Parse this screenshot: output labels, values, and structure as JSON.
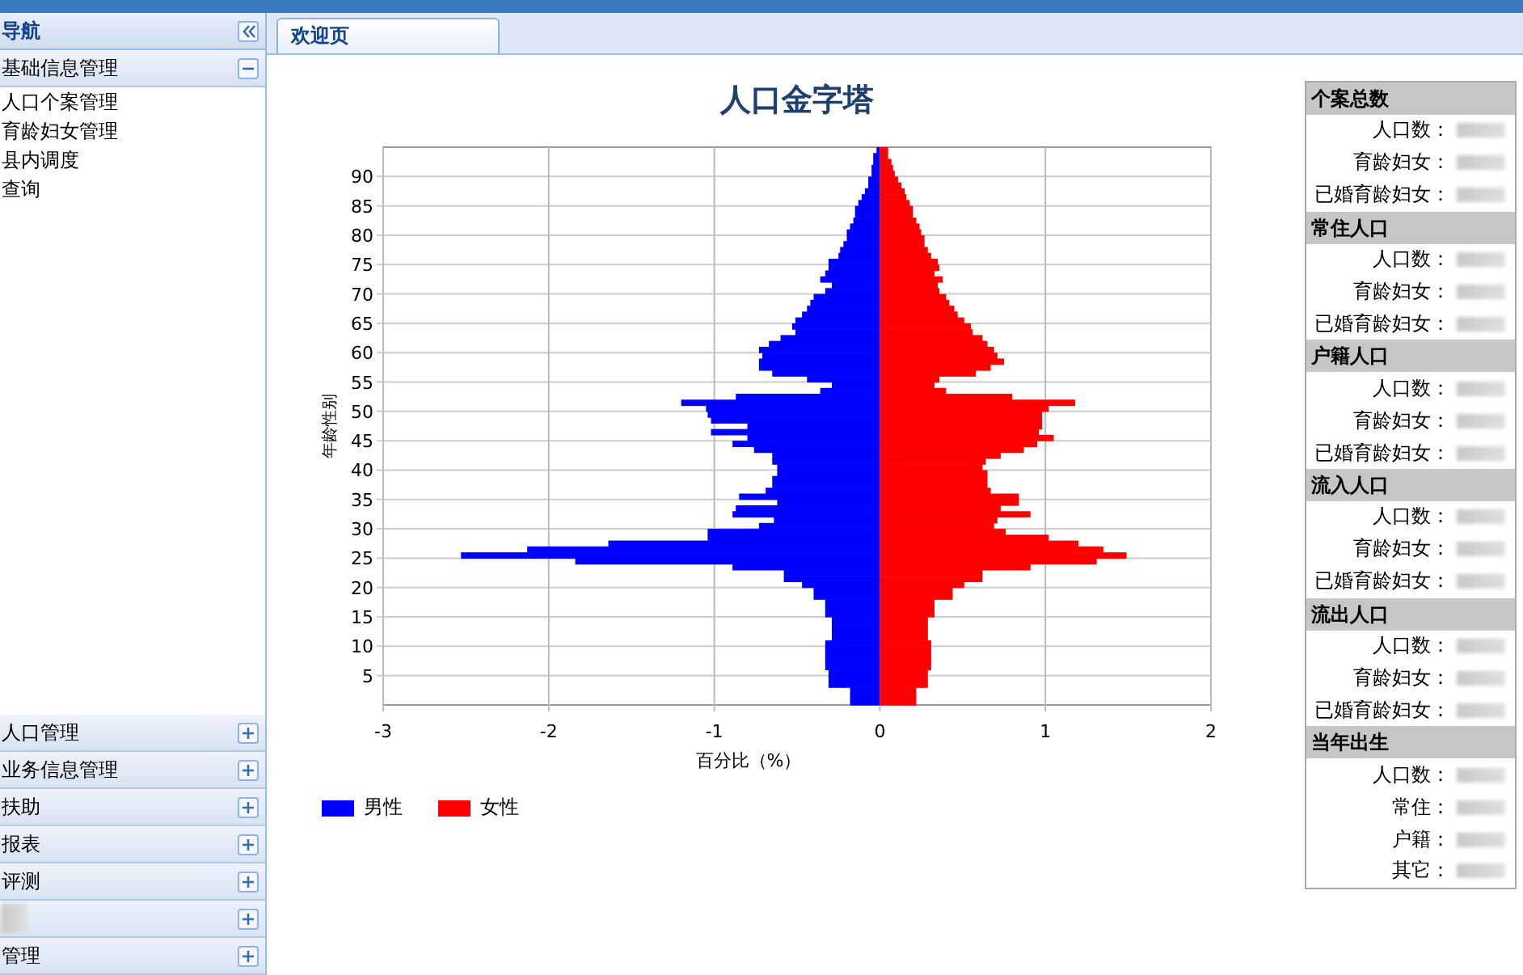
{
  "sidebar": {
    "title": "导航",
    "sections": [
      {
        "label": "基础信息管理",
        "expanded": true,
        "items": [
          "人口个案管理",
          "育龄妇女管理",
          "县内调度",
          "查询"
        ]
      },
      {
        "label": "人口管理",
        "expanded": false
      },
      {
        "label": "业务信息管理",
        "expanded": false
      },
      {
        "label": "扶助",
        "expanded": false
      },
      {
        "label": "报表",
        "expanded": false
      },
      {
        "label": "评测",
        "expanded": false
      },
      {
        "redacted": true,
        "expanded": false
      },
      {
        "label": "管理",
        "expanded": false
      }
    ]
  },
  "tabs": [
    {
      "label": "欢迎页",
      "selected": true
    }
  ],
  "chart_data": {
    "type": "bar",
    "orientation": "horizontal",
    "stacked": true,
    "grid": true,
    "title": "人口金字塔",
    "xlabel": "百分比（%）",
    "ylabel": "年龄性别",
    "xlim": [
      -3,
      2
    ],
    "xticks": [
      -3,
      -2,
      -1,
      0,
      1,
      2
    ],
    "ylim": [
      0,
      95
    ],
    "yticks": [
      5,
      10,
      15,
      20,
      25,
      30,
      35,
      40,
      45,
      50,
      55,
      60,
      65,
      70,
      75,
      80,
      85,
      90
    ],
    "x": [
      94,
      93,
      92,
      91,
      90,
      89,
      88,
      87,
      86,
      85,
      84,
      83,
      82,
      81,
      80,
      79,
      78,
      77,
      76,
      75,
      74,
      73,
      72,
      71,
      70,
      69,
      68,
      67,
      66,
      65,
      64,
      63,
      62,
      61,
      60,
      59,
      58,
      57,
      56,
      55,
      54,
      53,
      52,
      51,
      50,
      49,
      48,
      47,
      46,
      45,
      44,
      43,
      42,
      41,
      40,
      39,
      38,
      37,
      36,
      35,
      34,
      33,
      32,
      31,
      30,
      29,
      28,
      27,
      26,
      25,
      24,
      23,
      22,
      21,
      20,
      19,
      18,
      17,
      16,
      15,
      14,
      13,
      12,
      11,
      10,
      9,
      8,
      7,
      6,
      5,
      4,
      3,
      2,
      1,
      0
    ],
    "series": [
      {
        "name": "男性",
        "color": "#0000ff",
        "values": [
          -0.02,
          -0.04,
          -0.04,
          -0.05,
          -0.05,
          -0.07,
          -0.07,
          -0.09,
          -0.11,
          -0.13,
          -0.15,
          -0.15,
          -0.16,
          -0.18,
          -0.2,
          -0.2,
          -0.22,
          -0.24,
          -0.25,
          -0.31,
          -0.31,
          -0.33,
          -0.36,
          -0.29,
          -0.33,
          -0.4,
          -0.42,
          -0.44,
          -0.47,
          -0.51,
          -0.53,
          -0.51,
          -0.6,
          -0.67,
          -0.73,
          -0.71,
          -0.73,
          -0.73,
          -0.65,
          -0.44,
          -0.29,
          -0.36,
          -0.87,
          -1.2,
          -1.05,
          -1.04,
          -1.02,
          -0.8,
          -1.02,
          -0.8,
          -0.89,
          -0.76,
          -0.65,
          -0.65,
          -0.62,
          -0.62,
          -0.65,
          -0.65,
          -0.69,
          -0.85,
          -0.62,
          -0.87,
          -0.89,
          -0.64,
          -0.73,
          -1.04,
          -1.04,
          -1.64,
          -2.13,
          -2.53,
          -1.84,
          -0.89,
          -0.58,
          -0.58,
          -0.47,
          -0.4,
          -0.4,
          -0.33,
          -0.33,
          -0.33,
          -0.29,
          -0.29,
          -0.29,
          -0.29,
          -0.33,
          -0.33,
          -0.33,
          -0.33,
          -0.33,
          -0.31,
          -0.31,
          -0.31,
          -0.18,
          -0.18,
          -0.18
        ]
      },
      {
        "name": "女性",
        "color": "#ff0000",
        "values": [
          0.05,
          0.05,
          0.07,
          0.08,
          0.09,
          0.11,
          0.13,
          0.15,
          0.16,
          0.18,
          0.2,
          0.2,
          0.22,
          0.24,
          0.25,
          0.27,
          0.27,
          0.29,
          0.31,
          0.35,
          0.36,
          0.33,
          0.38,
          0.35,
          0.36,
          0.4,
          0.42,
          0.45,
          0.47,
          0.51,
          0.55,
          0.56,
          0.62,
          0.65,
          0.69,
          0.71,
          0.75,
          0.67,
          0.58,
          0.36,
          0.33,
          0.4,
          0.8,
          1.18,
          1.02,
          0.98,
          0.98,
          0.98,
          0.96,
          1.05,
          0.95,
          0.87,
          0.73,
          0.64,
          0.62,
          0.65,
          0.65,
          0.65,
          0.67,
          0.84,
          0.84,
          0.73,
          0.91,
          0.71,
          0.69,
          0.76,
          1.02,
          1.2,
          1.35,
          1.49,
          1.31,
          0.91,
          0.62,
          0.62,
          0.51,
          0.44,
          0.44,
          0.33,
          0.33,
          0.33,
          0.29,
          0.29,
          0.29,
          0.29,
          0.31,
          0.31,
          0.31,
          0.31,
          0.31,
          0.29,
          0.29,
          0.29,
          0.22,
          0.22,
          0.22
        ]
      }
    ]
  },
  "stats": [
    {
      "title": "个案总数",
      "rows": [
        "人口数：",
        "育龄妇女：",
        "已婚育龄妇女："
      ]
    },
    {
      "title": "常住人口",
      "rows": [
        "人口数：",
        "育龄妇女：",
        "已婚育龄妇女："
      ]
    },
    {
      "title": "户籍人口",
      "rows": [
        "人口数：",
        "育龄妇女：",
        "已婚育龄妇女："
      ]
    },
    {
      "title": "流入人口",
      "rows": [
        "人口数：",
        "育龄妇女：",
        "已婚育龄妇女："
      ]
    },
    {
      "title": "流出人口",
      "rows": [
        "人口数：",
        "育龄妇女：",
        "已婚育龄妇女："
      ]
    },
    {
      "title": "当年出生",
      "rows": [
        "人口数：",
        "常住：",
        "户籍：",
        "其它："
      ]
    }
  ]
}
